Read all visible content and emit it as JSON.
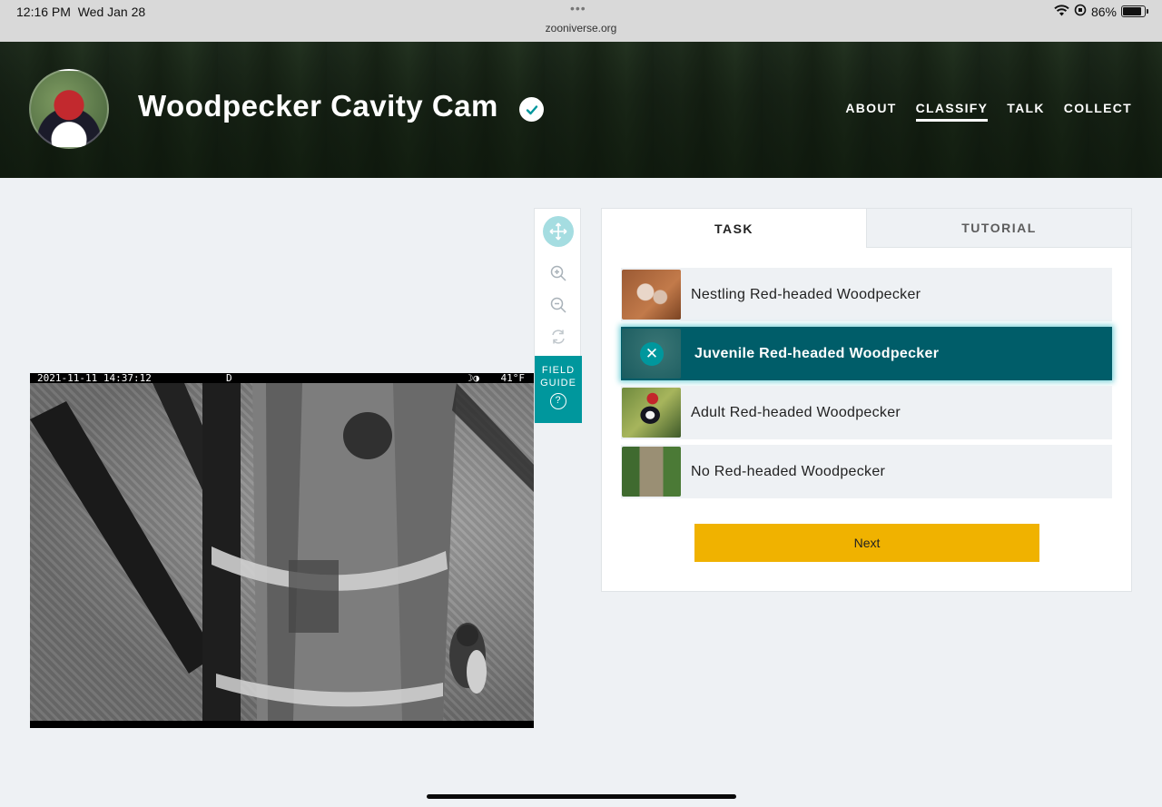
{
  "status_bar": {
    "time": "12:16 PM",
    "date": "Wed Jan 28",
    "dots": "•••",
    "url": "zooniverse.org",
    "battery": "86%",
    "battery_level": 0.86
  },
  "header": {
    "title": "Woodpecker Cavity Cam",
    "nav": [
      {
        "label": "ABOUT",
        "active": false
      },
      {
        "label": "CLASSIFY",
        "active": true
      },
      {
        "label": "TALK",
        "active": false
      },
      {
        "label": "COLLECT",
        "active": false
      }
    ]
  },
  "subject": {
    "timestamp": "2021-11-11 14:37:12",
    "mode": "D",
    "moon": "☽◑",
    "temperature": "41°F"
  },
  "toolbar": {
    "field_guide_label": "FIELD GUIDE",
    "help_glyph": "?"
  },
  "task_panel": {
    "tabs": [
      {
        "label": "TASK",
        "active": true
      },
      {
        "label": "TUTORIAL",
        "active": false
      }
    ],
    "answers": [
      {
        "label": "Nestling Red-headed Woodpecker",
        "selected": false
      },
      {
        "label": "Juvenile Red-headed Woodpecker",
        "selected": true
      },
      {
        "label": "Adult Red-headed Woodpecker",
        "selected": false
      },
      {
        "label": "No Red-headed Woodpecker",
        "selected": false
      }
    ],
    "next_label": "Next"
  },
  "colors": {
    "accent": "#00979d",
    "selected_bg": "#005d69",
    "next_button": "#f0b200",
    "page_bg": "#eef1f4"
  }
}
